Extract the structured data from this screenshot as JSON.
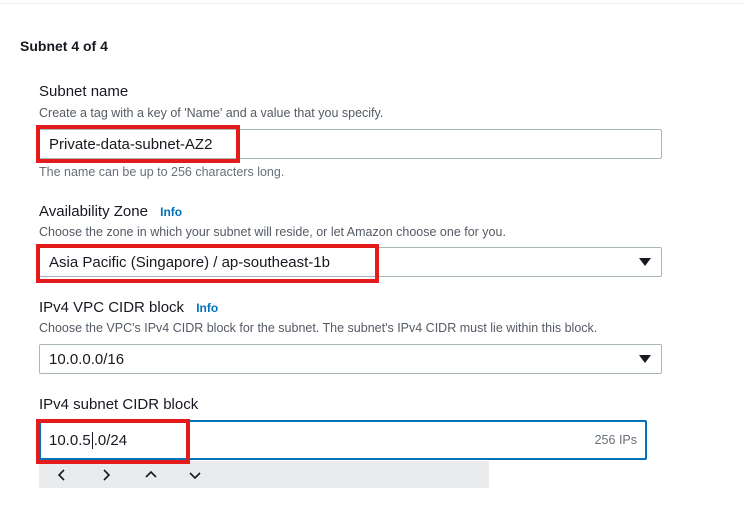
{
  "section": {
    "title": "Subnet 4 of 4"
  },
  "subnet_name": {
    "label": "Subnet name",
    "description": "Create a tag with a key of 'Name' and a value that you specify.",
    "value": "Private-data-subnet-AZ2",
    "constraint": "The name can be up to 256 characters long."
  },
  "availability_zone": {
    "label": "Availability Zone",
    "info": "Info",
    "description": "Choose the zone in which your subnet will reside, or let Amazon choose one for you.",
    "selected": "Asia Pacific (Singapore) / ap-southeast-1b"
  },
  "vpc_cidr": {
    "label": "IPv4 VPC CIDR block",
    "info": "Info",
    "description": "Choose the VPC's IPv4 CIDR block for the subnet. The subnet's IPv4 CIDR must lie within this block.",
    "selected": "10.0.0.0/16"
  },
  "subnet_cidr": {
    "label": "IPv4 subnet CIDR block",
    "value_before_cursor": "10.0.5",
    "value_after_cursor": ".0/24",
    "suffix": "256 IPs"
  },
  "stepper": {
    "icons": [
      "chevron-left-icon",
      "chevron-right-icon",
      "chevron-up-icon",
      "chevron-down-icon"
    ]
  },
  "colors": {
    "accent": "#0073bb",
    "highlight": "#e31b1b",
    "text": "#16191f",
    "muted": "#545b64"
  }
}
